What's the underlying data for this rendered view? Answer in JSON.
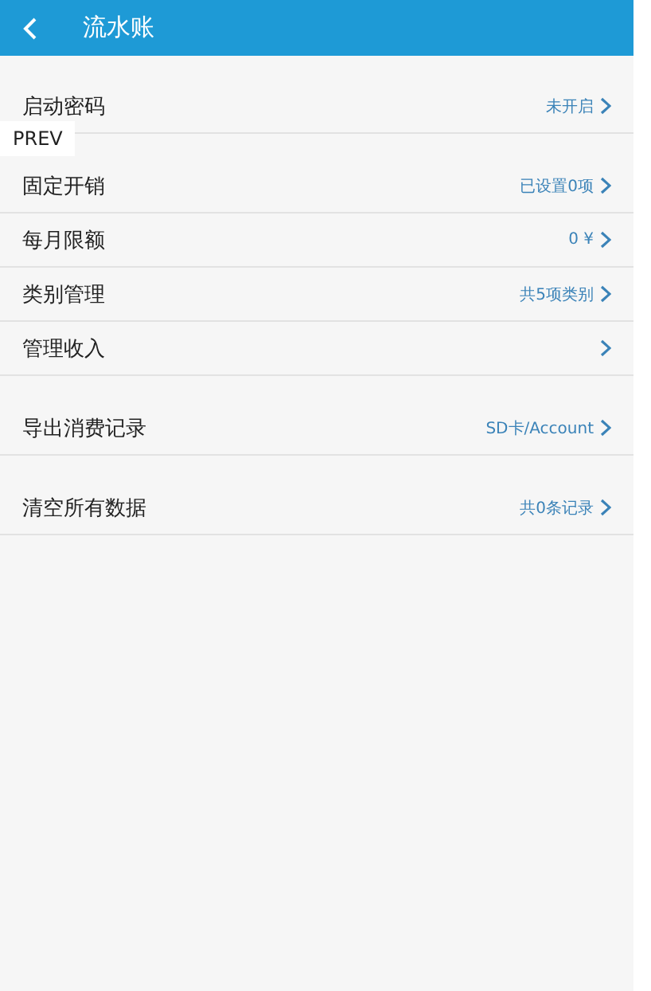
{
  "header": {
    "title": "流水账"
  },
  "overlay_button": {
    "label": "PREV"
  },
  "groups": [
    {
      "rows": [
        {
          "label": "启动密码",
          "value": "未开启"
        }
      ]
    },
    {
      "rows": [
        {
          "label": "固定开销",
          "value": "已设置0项"
        },
        {
          "label": "每月限额",
          "value": "0 ¥"
        },
        {
          "label": "类别管理",
          "value": "共5项类别"
        },
        {
          "label": "管理收入"
        }
      ]
    },
    {
      "rows": [
        {
          "label": "导出消费记录",
          "value": "SD卡/Account"
        }
      ]
    },
    {
      "rows": [
        {
          "label": "清空所有数据",
          "value": "共0条记录"
        }
      ]
    }
  ]
}
